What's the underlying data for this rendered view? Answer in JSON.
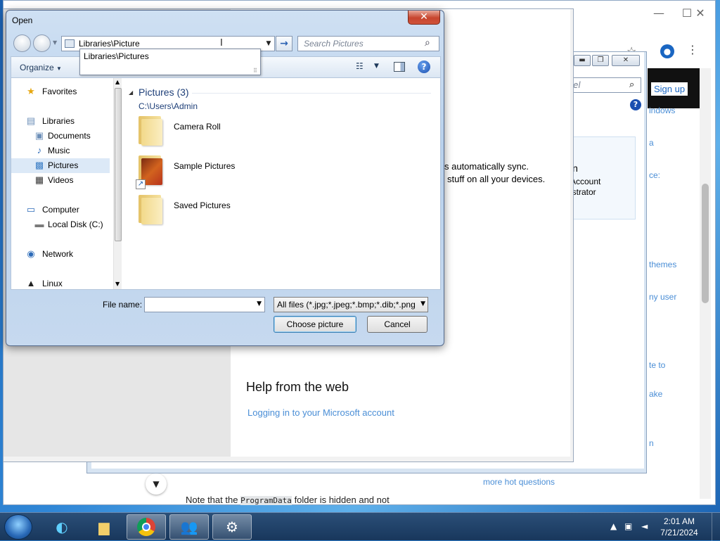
{
  "dialog": {
    "title": "Open",
    "address": "Libraries\\Picture",
    "address_suggestion": "Libraries\\Pictures",
    "search_placeholder": "Search Pictures",
    "organize_label": "Organize",
    "nav": [
      {
        "label": "Favorites",
        "icon": "star-icon"
      },
      {
        "label": "Libraries",
        "icon": "libraries-icon"
      },
      {
        "label": "Documents",
        "icon": "documents-icon"
      },
      {
        "label": "Music",
        "icon": "music-icon"
      },
      {
        "label": "Pictures",
        "icon": "pictures-icon"
      },
      {
        "label": "Videos",
        "icon": "videos-icon"
      },
      {
        "label": "Computer",
        "icon": "computer-icon"
      },
      {
        "label": "Local Disk (C:)",
        "icon": "disk-icon"
      },
      {
        "label": "Network",
        "icon": "network-icon"
      },
      {
        "label": "Linux",
        "icon": "linux-icon"
      }
    ],
    "group_title": "Pictures (3)",
    "group_path": "C:\\Users\\Admin",
    "items": [
      {
        "name": "Camera Roll"
      },
      {
        "name": "Sample Pictures"
      },
      {
        "name": "Saved Pictures"
      }
    ],
    "file_name_label": "File name:",
    "file_name_value": "",
    "filter": "All files (*.jpg;*.jpeg;*.bmp;*.dib;*.png",
    "choose_label": "Choose picture",
    "cancel_label": "Cancel"
  },
  "settings": {
    "sync_line1": "s automatically sync.",
    "sync_line2": "stuff on all your devices.",
    "help_title": "Help from the web",
    "help_link": "Logging in to your Microsoft account"
  },
  "explorer": {
    "search_fragment": "el",
    "account_line1": "in",
    "account_line2": "Account",
    "account_line3": "istrator"
  },
  "browser": {
    "signin": "Sign up",
    "side_links": [
      "indows",
      "a",
      "ce:",
      "themes",
      "ny user",
      "te to",
      "ake",
      "n"
    ],
    "more_questions": "more hot questions",
    "note": "Note that the",
    "note_code": "ProgramData",
    "note_end": "folder is hidden and not"
  },
  "taskbar": {
    "time": "2:01 AM",
    "date": "7/21/2024"
  }
}
